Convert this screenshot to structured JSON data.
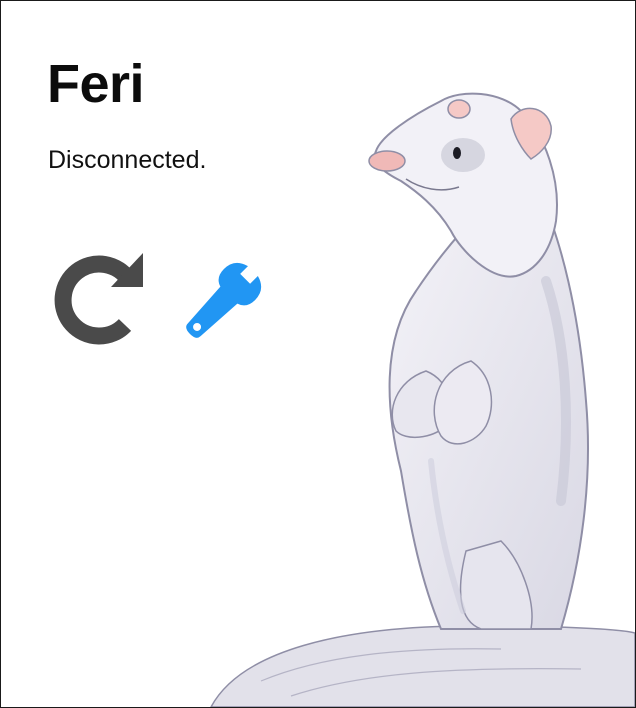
{
  "app": {
    "title": "Feri",
    "status_text": "Disconnected."
  },
  "actions": {
    "reload": {
      "icon": "reload-icon",
      "color": "#4a4a4a"
    },
    "settings": {
      "icon": "wrench-icon",
      "color": "#2196f3"
    }
  },
  "illustration": {
    "subject": "ferret-illustration"
  }
}
